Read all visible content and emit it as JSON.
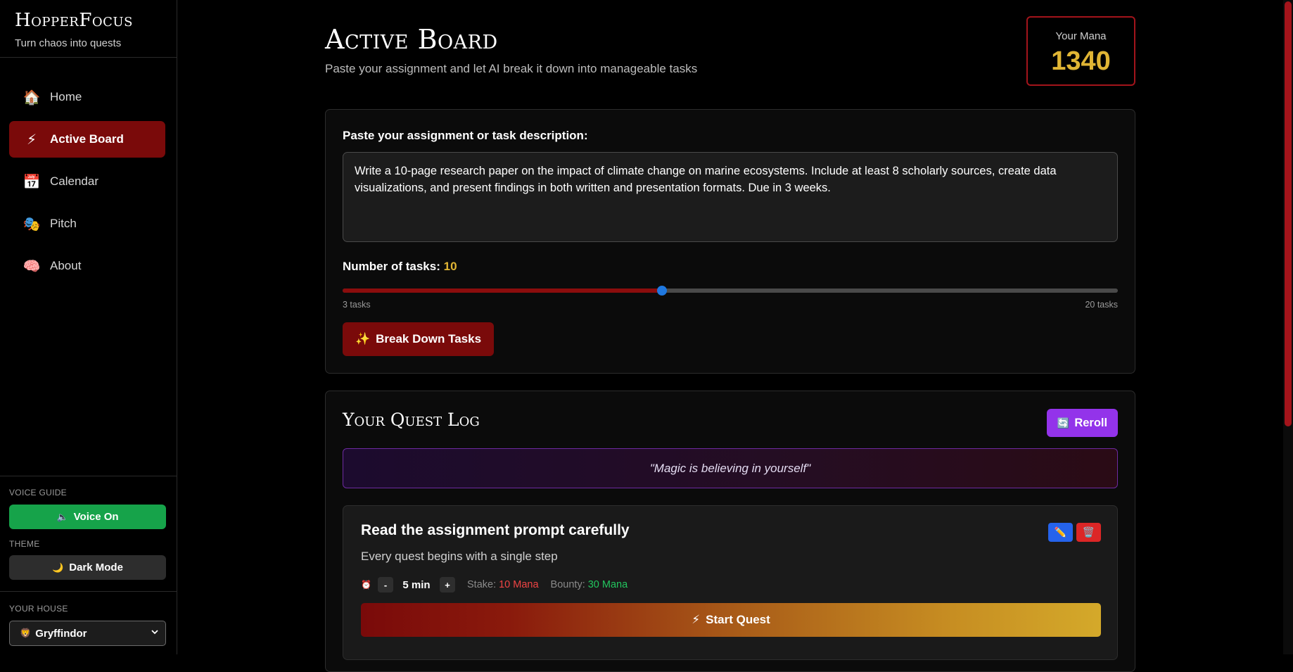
{
  "brand": {
    "title": "HopperFocus",
    "subtitle": "Turn chaos into quests"
  },
  "nav": [
    {
      "label": "Home",
      "icon": "house-icon",
      "glyph": "🏠",
      "active": false
    },
    {
      "label": "Active Board",
      "icon": "lightning-icon",
      "glyph": "⚡",
      "active": true
    },
    {
      "label": "Calendar",
      "icon": "calendar-icon",
      "glyph": "📅",
      "active": false
    },
    {
      "label": "Pitch",
      "icon": "theater-masks-icon",
      "glyph": "🎭",
      "active": false
    },
    {
      "label": "About",
      "icon": "brain-icon",
      "glyph": "🧠",
      "active": false
    }
  ],
  "sidebar_controls": {
    "voice_label": "VOICE GUIDE",
    "voice_button": "Voice On",
    "theme_label": "THEME",
    "theme_button": "Dark Mode",
    "house_label": "YOUR HOUSE",
    "house_selected": "Gryffindor"
  },
  "header": {
    "title": "Active Board",
    "subtitle": "Paste your assignment and let AI break it down into manageable tasks"
  },
  "mana": {
    "label": "Your Mana",
    "value": "1340"
  },
  "assignment": {
    "label": "Paste your assignment or task description:",
    "text": "Write a 10-page research paper on the impact of climate change on marine ecosystems. Include at least 8 scholarly sources, create data visualizations, and present findings in both written and presentation formats. Due in 3 weeks.",
    "tasks_label": "Number of tasks:",
    "tasks_value": 10,
    "slider_min": 3,
    "slider_max": 20,
    "min_label": "3 tasks",
    "max_label": "20 tasks",
    "breakdown_button": "Break Down Tasks"
  },
  "quest_log": {
    "title": "Your Quest Log",
    "reroll_button": "Reroll",
    "quote": "\"Magic is believing in yourself\"",
    "quests": [
      {
        "title": "Read the assignment prompt carefully",
        "description": "Every quest begins with a single step",
        "duration": "5 min",
        "stake_label": "Stake:",
        "stake": "10 Mana",
        "bounty_label": "Bounty:",
        "bounty": "30 Mana",
        "start_button": "Start Quest"
      }
    ]
  },
  "colors": {
    "accent_red": "#7a0a0a",
    "gold": "#e0b534",
    "purple": "#9333ea",
    "green": "#16a34a"
  }
}
